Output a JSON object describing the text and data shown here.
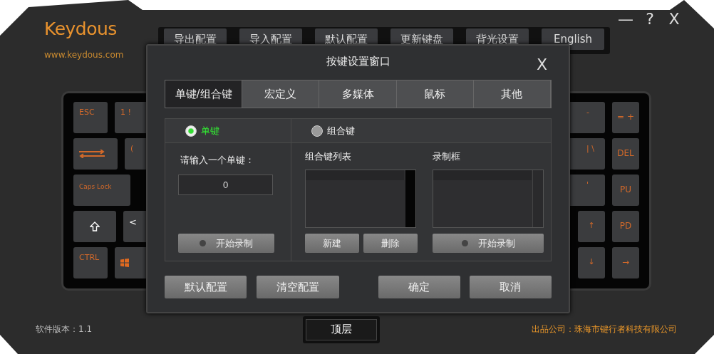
{
  "app": {
    "logo": "Keydous",
    "website": "www.keydous.com"
  },
  "window_controls": [
    "—",
    "?",
    "X"
  ],
  "toolbar": [
    {
      "label": "导出配置"
    },
    {
      "label": "导入配置"
    },
    {
      "label": "默认配置"
    },
    {
      "label": "更新键盘"
    },
    {
      "label": "背光设置"
    },
    {
      "label": "English"
    }
  ],
  "keyboard": {
    "left_rows": [
      [
        {
          "kind": "text",
          "label": "ESC"
        },
        {
          "kind": "text",
          "label": "1 !"
        }
      ],
      [
        {
          "kind": "tab"
        },
        {
          "kind": "text",
          "label": "("
        }
      ],
      [
        {
          "kind": "text",
          "label": "Caps Lock"
        }
      ],
      [
        {
          "kind": "shift"
        },
        {
          "kind": "text",
          "label": "<"
        }
      ],
      [
        {
          "kind": "text",
          "label": "CTRL"
        },
        {
          "kind": "windows"
        }
      ]
    ],
    "right_rows": [
      [
        {
          "kind": "text",
          "label": "-"
        },
        {
          "kind": "text",
          "label": "= +"
        }
      ],
      [
        {
          "kind": "text",
          "label": "| \\"
        },
        {
          "kind": "text",
          "label": "DEL"
        }
      ],
      [
        {
          "kind": "text",
          "label": "'"
        },
        {
          "kind": "text",
          "label": "PU"
        }
      ],
      [
        {
          "kind": "arrow",
          "label": "↑"
        },
        {
          "kind": "text",
          "label": "PD"
        }
      ],
      [
        {
          "kind": "arrow",
          "label": "↓"
        },
        {
          "kind": "text",
          "label": "→"
        }
      ]
    ]
  },
  "dialog": {
    "title": "按键设置窗口",
    "close": "X",
    "tabs": [
      {
        "label": "单键/组合键",
        "selected": true
      },
      {
        "label": "宏定义",
        "selected": false
      },
      {
        "label": "多媒体",
        "selected": false
      },
      {
        "label": "鼠标",
        "selected": false
      },
      {
        "label": "其他",
        "selected": false
      }
    ],
    "single_key": {
      "label": "单键",
      "selected": true,
      "prompt": "请输入一个单键：",
      "value": "0",
      "record_button": "开始录制"
    },
    "combo_key": {
      "label": "组合键",
      "selected": false,
      "list_label": "组合键列表",
      "record_label": "录制框",
      "new_button": "新建",
      "delete_button": "删除",
      "record_button": "开始录制"
    },
    "buttons": [
      "默认配置",
      "清空配置",
      "确定",
      "取消"
    ]
  },
  "topmost_button": "顶层",
  "version": "软件版本：1.1",
  "company": "出品公司：珠海市键行者科技有限公司"
}
